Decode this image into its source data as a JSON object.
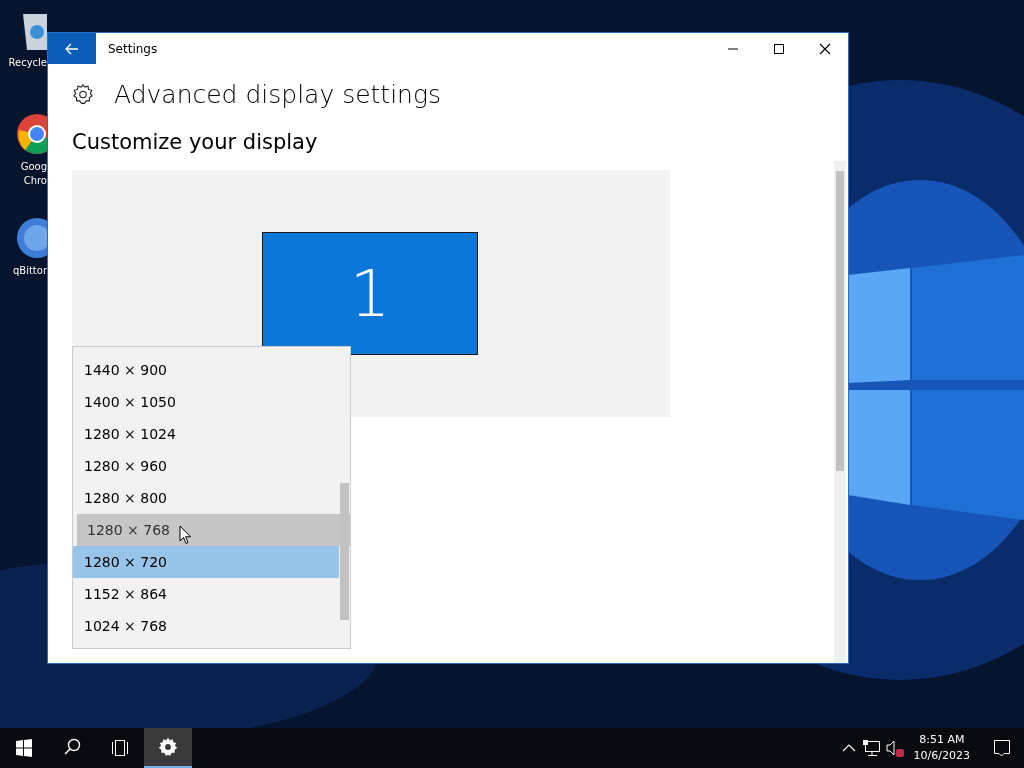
{
  "desktop_icons": [
    {
      "kind": "recycle",
      "lines": [
        "Recycle"
      ]
    },
    {
      "kind": "chrome",
      "lines": [
        "Goog",
        "Chro"
      ]
    },
    {
      "kind": "qbittorrent",
      "lines": [
        "qBittor"
      ]
    }
  ],
  "window": {
    "title": "Settings",
    "heading": "Advanced display settings",
    "section": "Customize your display",
    "monitor_number": "1"
  },
  "resolution_list": [
    {
      "label": "1440 × 900",
      "selected": false,
      "hovered": false
    },
    {
      "label": "1400 × 1050",
      "selected": false,
      "hovered": false
    },
    {
      "label": "1280 × 1024",
      "selected": false,
      "hovered": false
    },
    {
      "label": "1280 × 960",
      "selected": false,
      "hovered": false
    },
    {
      "label": "1280 × 800",
      "selected": false,
      "hovered": false
    },
    {
      "label": "1280 × 768",
      "selected": false,
      "hovered": true
    },
    {
      "label": "1280 × 720",
      "selected": true,
      "hovered": false
    },
    {
      "label": "1152 × 864",
      "selected": false,
      "hovered": false
    },
    {
      "label": "1024 × 768",
      "selected": false,
      "hovered": false
    }
  ],
  "taskbar": {
    "apps": [
      {
        "kind": "settings",
        "active": true
      }
    ],
    "time": "8:51 AM",
    "date": "10/6/2023",
    "volume_muted": true
  }
}
